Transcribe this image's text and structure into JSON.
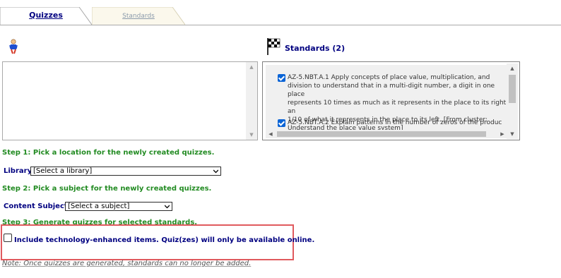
{
  "tabs": [
    {
      "label": "Quizzes",
      "active": true
    },
    {
      "label": "Standards",
      "active": false
    }
  ],
  "standards_panel": {
    "title": "Standards (2)",
    "items": [
      {
        "checked": true,
        "text": "AZ-5.NBT.A.1 Apply concepts of place value, multiplication, and\ndivision to understand that in a multi-digit number, a digit in one place\nrepresents 10 times as much as it represents in the place to its right an\n1/10 of what it represents in the place to its left. [From cluster:\nUnderstand the place value system]"
      },
      {
        "checked": true,
        "text": "AZ-5.NBT.A.2 Explain patterns in the number of zeros of the produc"
      }
    ]
  },
  "steps": {
    "step1": "Step 1:  Pick a location for the newly created quizzes.",
    "step2": "Step 2:  Pick a subject for the newly created quizzes.",
    "step3": "Step 3:  Generate quizzes for selected standards."
  },
  "library": {
    "label": "Library",
    "selected": "[Select a library]"
  },
  "subject": {
    "label": "Content Subject:",
    "selected": "[Select a subject]"
  },
  "tech_option": {
    "checked": false,
    "label": "Include technology-enhanced items. Quiz(zes) will only be available online."
  },
  "note": "Note: Once quizzes are generated, standards can no longer be added.",
  "colors": {
    "highlight": "#e05a5e",
    "heading_blue": "#000080",
    "step_green": "#228b22"
  }
}
